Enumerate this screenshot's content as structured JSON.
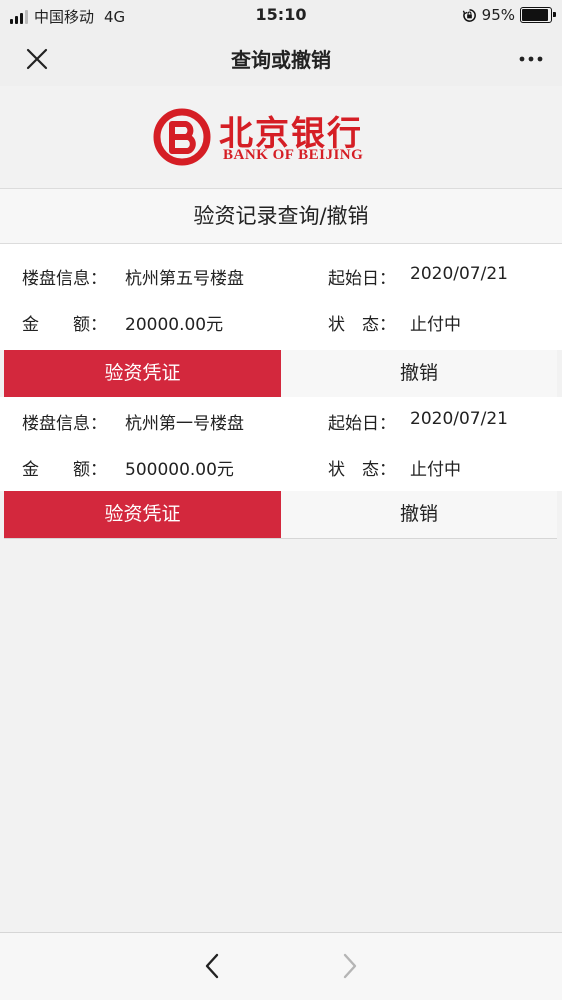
{
  "status_bar": {
    "carrier": "中国移动",
    "network": "4G",
    "time": "15:10",
    "battery": "95%"
  },
  "nav": {
    "title": "查询或撤销"
  },
  "bank": {
    "name_cn": "北京银行",
    "name_en": "BANK OF BEIJING",
    "brand_color": "#d51e25"
  },
  "section": {
    "title": "验资记录查询/撤销"
  },
  "records": [
    {
      "project_label": "楼盘信息：",
      "project": "杭州第五号楼盘",
      "start_label": "起始日：",
      "start_date": "2020/07/21",
      "amount_label": "金　　额：",
      "amount": "20000.00元",
      "status_label": "状　态：",
      "status": "止付中",
      "primary_btn": "验资凭证",
      "secondary_btn": "撤销"
    },
    {
      "project_label": "楼盘信息：",
      "project": "杭州第一号楼盘",
      "start_label": "起始日：",
      "start_date": "2020/07/21",
      "amount_label": "金　　额：",
      "amount": "500000.00元",
      "status_label": "状　态：",
      "status": "止付中",
      "primary_btn": "验资凭证",
      "secondary_btn": "撤销"
    }
  ],
  "colors": {
    "primary_button": "#d3283d",
    "page_bg": "#f2f2f2"
  },
  "icons": {
    "close": "close-icon",
    "more": "more-icon",
    "back": "chevron-left-icon",
    "forward": "chevron-right-icon"
  }
}
